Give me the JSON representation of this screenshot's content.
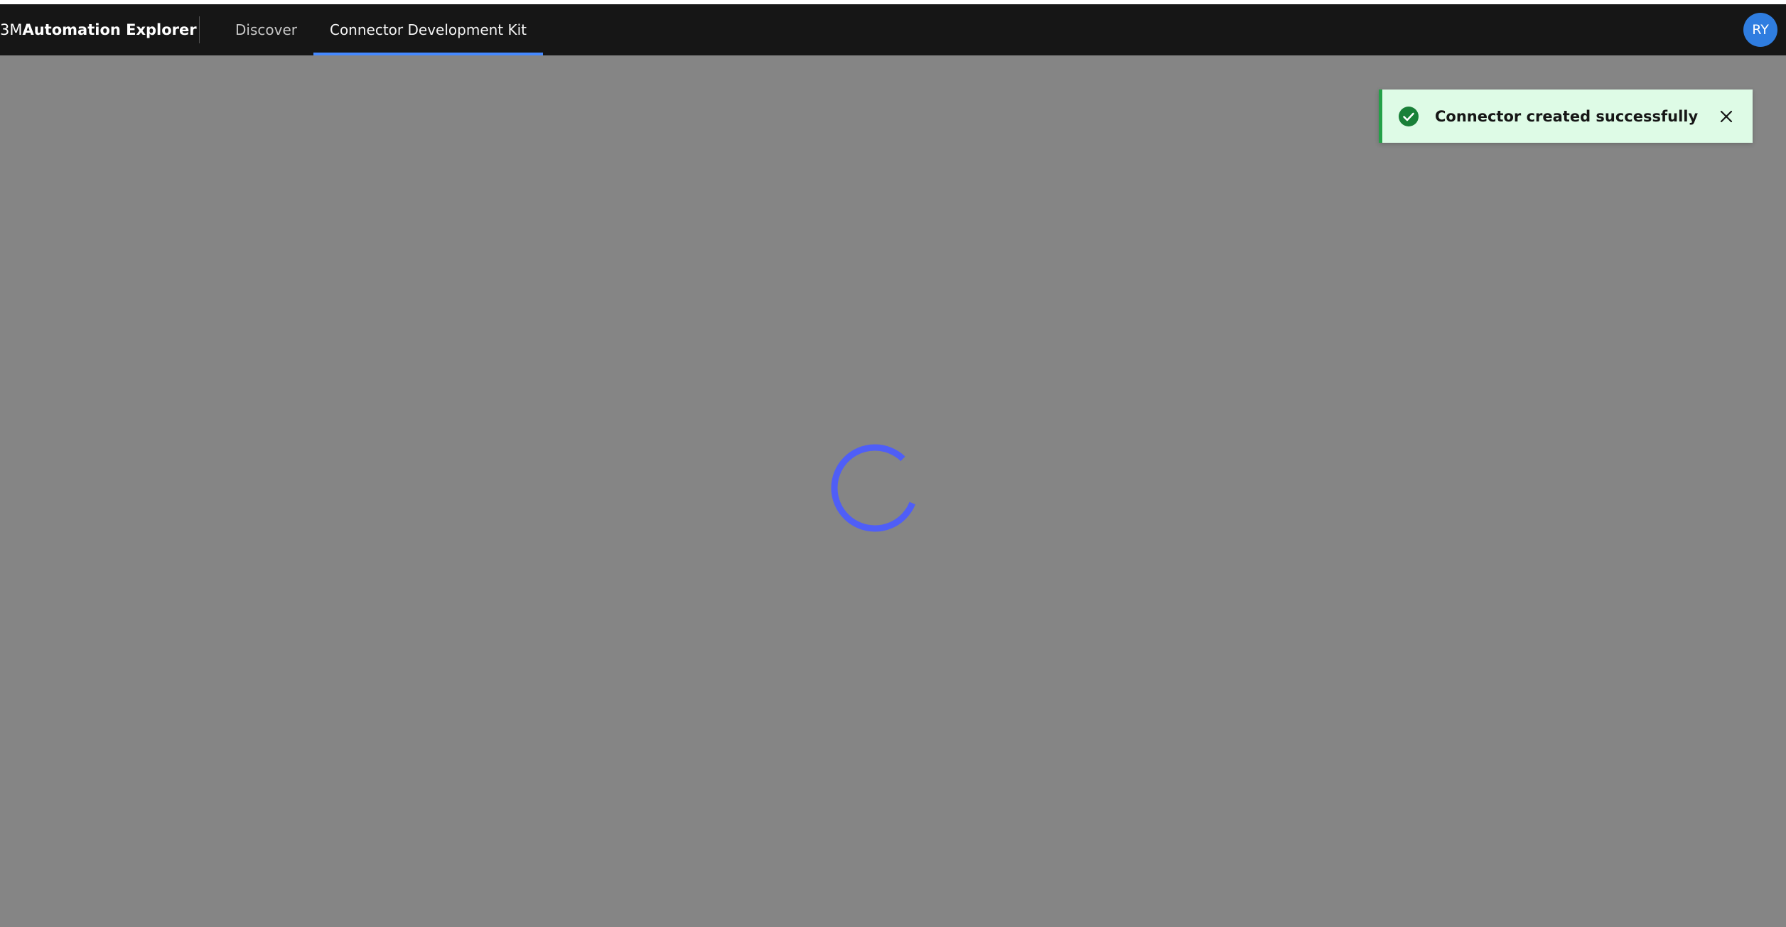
{
  "header": {
    "brand_prefix": "3M",
    "brand_name": "Automation Explorer",
    "nav": [
      {
        "label": "Discover",
        "active": false
      },
      {
        "label": "Connector Development Kit",
        "active": true
      }
    ],
    "avatar_initials": "RY"
  },
  "loading": {
    "icon": "loading-spinner-icon",
    "color": "#4f5ef7"
  },
  "toast": {
    "kind": "success",
    "icon": "checkmark-filled-icon",
    "message": "Connector created successfully",
    "close_icon": "close-icon",
    "background": "#defbe6",
    "accent": "#24a148"
  },
  "colors": {
    "header_bg": "#161616",
    "overlay": "#858585",
    "nav_active_underline": "#4589ff",
    "avatar_bg": "#2f7de0"
  }
}
